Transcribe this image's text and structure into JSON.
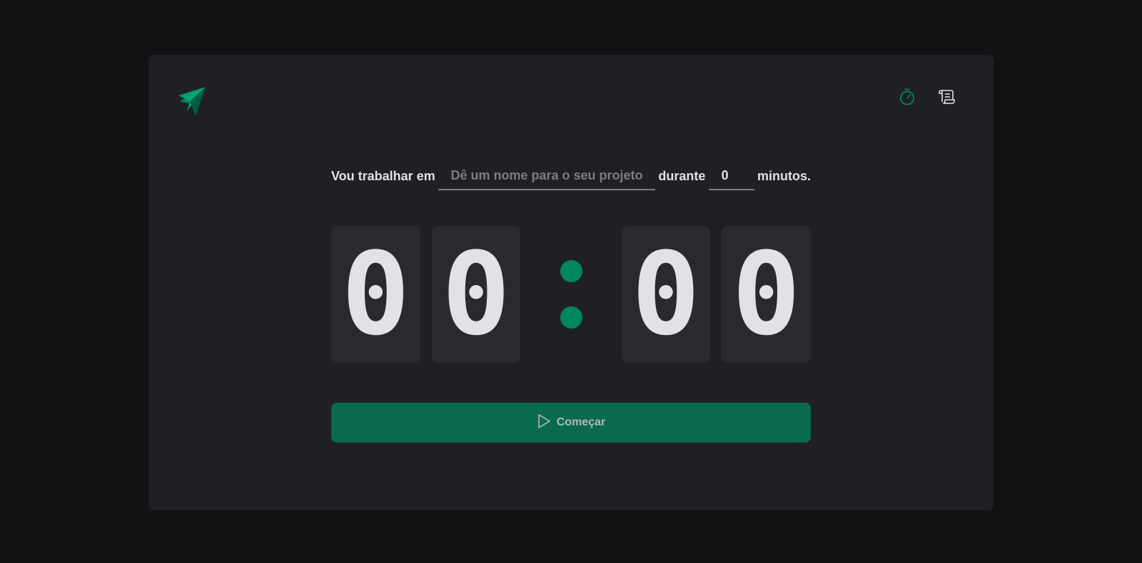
{
  "header": {
    "logo_icon": "ignite-logo-icon",
    "nav": [
      {
        "icon": "timer-icon",
        "color": "#00875f"
      },
      {
        "icon": "scroll-icon",
        "color": "#e1e1e6"
      }
    ]
  },
  "form": {
    "task_label": "Vou trabalhar em",
    "task_placeholder": "Dê um nome para o seu projeto",
    "duration_label": "durante",
    "minutes_value": "0",
    "minutes_suffix": "minutos."
  },
  "countdown": {
    "minutes_tens": "0",
    "minutes_ones": "0",
    "seconds_tens": "0",
    "seconds_ones": "0"
  },
  "start_button": {
    "label": "Começar",
    "icon": "play-icon"
  },
  "colors": {
    "background": "#121214",
    "card": "#202024",
    "accent": "#00875f",
    "button": "#0a6a4e"
  }
}
